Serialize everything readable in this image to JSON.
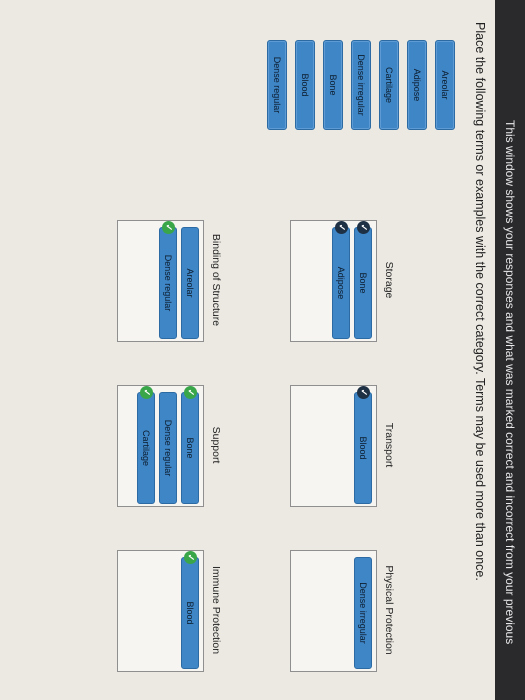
{
  "banner": {
    "text": "This window shows your responses and what was marked correct and incorrect from your previous"
  },
  "instruction": "Place the following terms or examples with the correct category. Terms may be used more than once.",
  "bank": [
    "Areolar",
    "Adipose",
    "Cartilage",
    "Dense irregular",
    "Bone",
    "Blood",
    "Dense regular"
  ],
  "zones": {
    "storage": {
      "label": "Storage",
      "items": [
        "Bone",
        "Adipose"
      ]
    },
    "transport": {
      "label": "Transport",
      "items": [
        "Blood"
      ]
    },
    "physical_protection": {
      "label": "Physical Protection",
      "items": [
        "Dense irregular"
      ]
    },
    "binding": {
      "label": "Binding of Structure",
      "items": [
        "Areolar",
        "Dense regular"
      ]
    },
    "support": {
      "label": "Support",
      "items": [
        "Bone",
        "Dense regular",
        "Cartilage"
      ]
    },
    "immune": {
      "label": "Immune Protection",
      "items": [
        "Blood"
      ]
    }
  },
  "colors": {
    "tile": "#3f86c7",
    "check": "#3aa64a",
    "banner": "#2a2a2c"
  }
}
